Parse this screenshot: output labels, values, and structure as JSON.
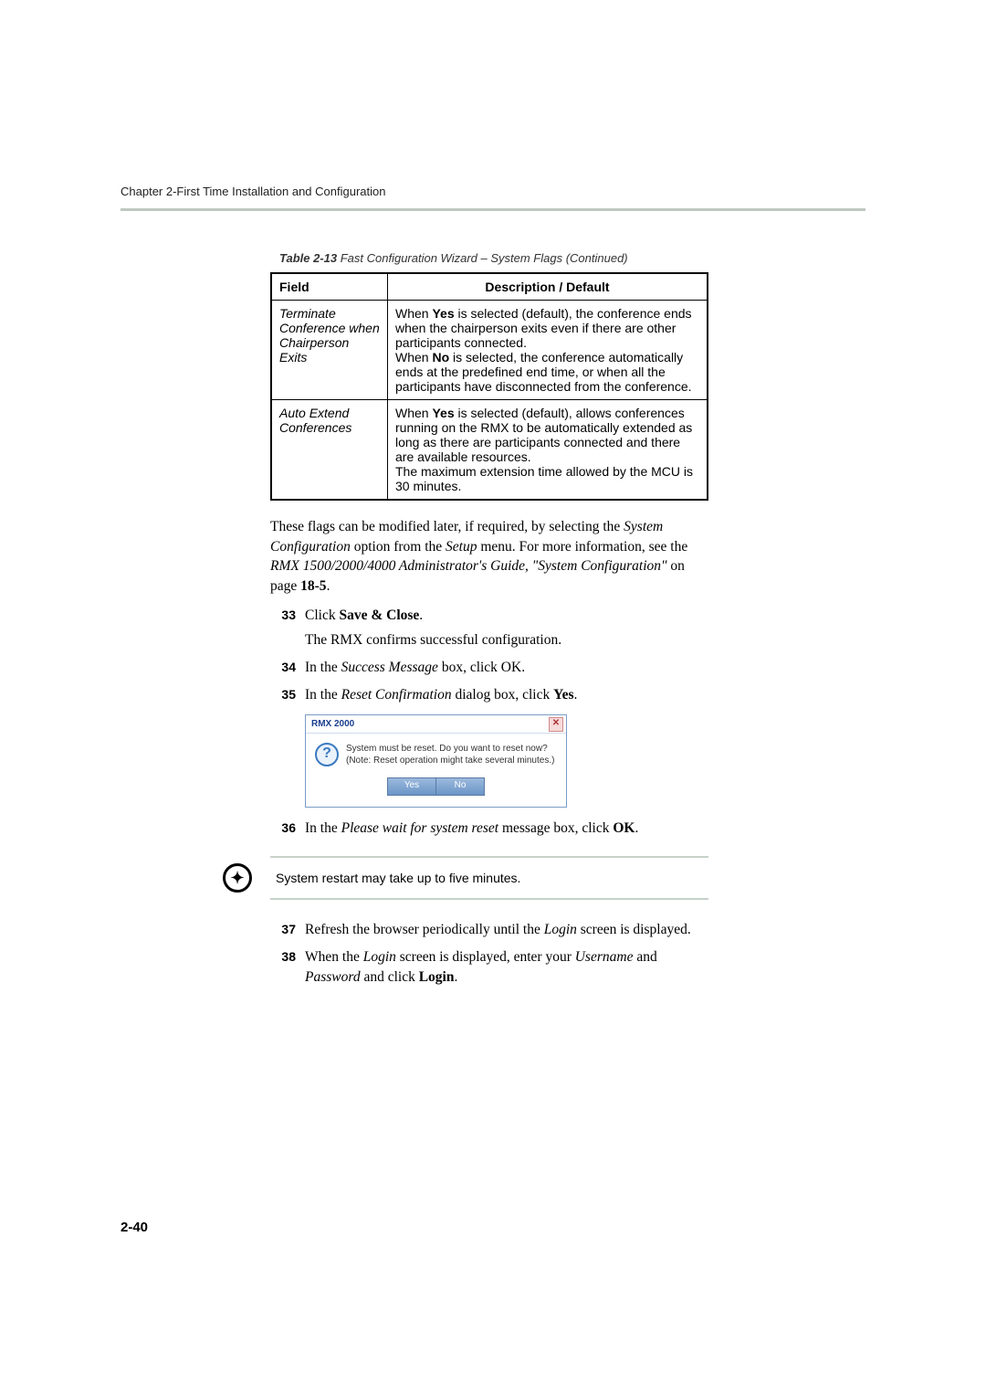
{
  "header": "Chapter 2-First Time Installation and Configuration",
  "caption_bold": "Table 2-13",
  "caption_rest": "   Fast Configuration Wizard – System Flags (Continued)",
  "table": {
    "h1": "Field",
    "h2": "Description / Default",
    "rows": [
      {
        "field": "Terminate Conference when Chairperson Exits",
        "desc": {
          "p1a": "When ",
          "p1b": "Yes",
          "p1c": " is selected (default), the conference ends when the chairperson exits even if there are other participants connected.",
          "p2a": "When ",
          "p2b": "No",
          "p2c": " is selected, the conference automatically ends at the predefined end time, or when all the participants have disconnected from the conference."
        }
      },
      {
        "field": "Auto Extend Conferences",
        "desc": {
          "p1a": "When ",
          "p1b": "Yes",
          "p1c": " is selected (default), allows conferences running on the RMX to be automatically extended as long as there are participants connected and there are available resources.",
          "p2": "The maximum extension time allowed by the MCU is 30 minutes."
        }
      }
    ]
  },
  "para": {
    "t1": "These flags can be modified later, if required, by selecting the ",
    "i1": "System Configuration",
    "t2": " option from the ",
    "i2": "Setup",
    "t3": " menu. For more information, see the ",
    "i3": "RMX 1500/2000/4000 Administrator's Guide",
    "t4": ", ",
    "i4": "\"System Configuration\"",
    "t5": " on page ",
    "b1": "18-5",
    "t6": "."
  },
  "steps": {
    "s33_num": "33",
    "s33_a": "Click ",
    "s33_b": "Save & Close",
    "s33_c": ".",
    "s33_sub": "The RMX confirms successful configuration.",
    "s34_num": "34",
    "s34_a": "In the ",
    "s34_i": "Success Message",
    "s34_b": " box, click OK.",
    "s35_num": "35",
    "s35_a": "In the ",
    "s35_i": "Reset Confirmation",
    "s35_b": " dialog box, click ",
    "s35_c": "Yes",
    "s35_d": ".",
    "s36_num": "36",
    "s36_a": "In the ",
    "s36_i": "Please wait for system reset",
    "s36_b": " message box, click ",
    "s36_c": "OK",
    "s36_d": ".",
    "s37_num": "37",
    "s37_a": "Refresh the browser periodically until the ",
    "s37_i": "Login",
    "s37_b": " screen is displayed.",
    "s38_num": "38",
    "s38_a": "When the ",
    "s38_i1": "Login",
    "s38_b": " screen is displayed, enter your ",
    "s38_i2": "Username",
    "s38_c": " and ",
    "s38_i3": "Password",
    "s38_d": " and click ",
    "s38_e": "Login",
    "s38_f": "."
  },
  "dialog": {
    "title": "RMX 2000",
    "close": "✕",
    "q": "?",
    "line1": "System must be reset. Do you want to reset now?",
    "line2": "(Note: Reset operation might take several minutes.)",
    "yes": "Yes",
    "no": "No"
  },
  "note": "System restart may take up to five minutes.",
  "note_icon": "✦",
  "page_num": "2-40"
}
